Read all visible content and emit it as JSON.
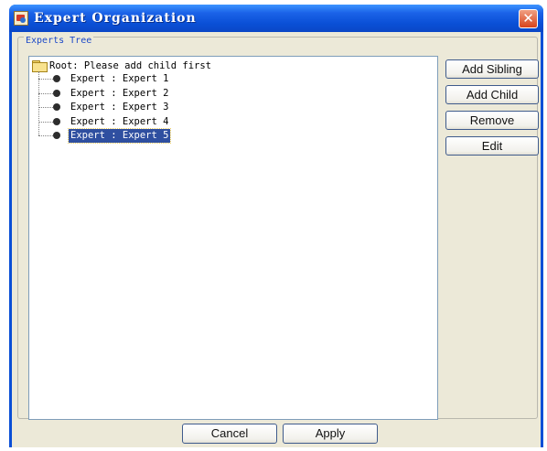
{
  "window": {
    "title": "Expert Organization",
    "close_glyph": "✕"
  },
  "group": {
    "title": "Experts Tree"
  },
  "tree": {
    "root_label": "Root: Please add child first",
    "root_icon": "folder-icon",
    "item_icon": "bullet-icon",
    "items": [
      {
        "label": "Expert : Expert 1",
        "selected": false
      },
      {
        "label": "Expert : Expert 2",
        "selected": false
      },
      {
        "label": "Expert : Expert 3",
        "selected": false
      },
      {
        "label": "Expert : Expert 4",
        "selected": false
      },
      {
        "label": "Expert : Expert 5",
        "selected": true
      }
    ]
  },
  "actions": {
    "add_sibling": "Add Sibling",
    "add_child": "Add Child",
    "remove": "Remove",
    "edit": "Edit"
  },
  "footer": {
    "cancel": "Cancel",
    "apply": "Apply"
  },
  "colors": {
    "titlebar": "#0a4fd6",
    "selection": "#2f4fa0",
    "dialog_bg": "#ece9d8",
    "group_title": "#1c49c8"
  }
}
